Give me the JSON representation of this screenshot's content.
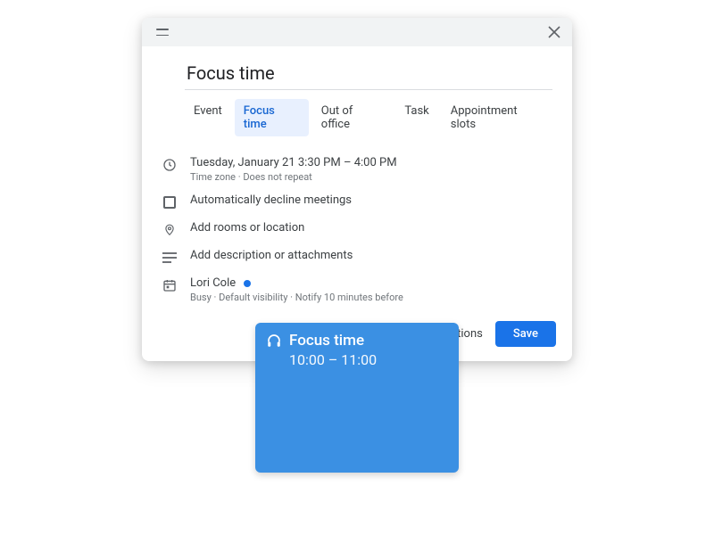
{
  "dialog": {
    "title": "Focus time",
    "tabs": [
      {
        "label": "Event"
      },
      {
        "label": "Focus time"
      },
      {
        "label": "Out of office"
      },
      {
        "label": "Task"
      },
      {
        "label": "Appointment slots"
      }
    ],
    "time_row": {
      "primary": "Tuesday, January 21    3:30 PM – 4:00 PM",
      "secondary": "Time zone · Does not repeat"
    },
    "decline_row": {
      "label": "Automatically decline meetings"
    },
    "location_row": {
      "label": "Add rooms or location"
    },
    "description_row": {
      "label": "Add description or attachments"
    },
    "owner_row": {
      "name": "Lori Cole",
      "secondary": "Busy · Default visibility · Notify 10 minutes before"
    },
    "footer": {
      "more_options": "More options",
      "save": "Save"
    }
  },
  "event_block": {
    "title": "Focus time",
    "time": "10:00 – 11:00"
  }
}
